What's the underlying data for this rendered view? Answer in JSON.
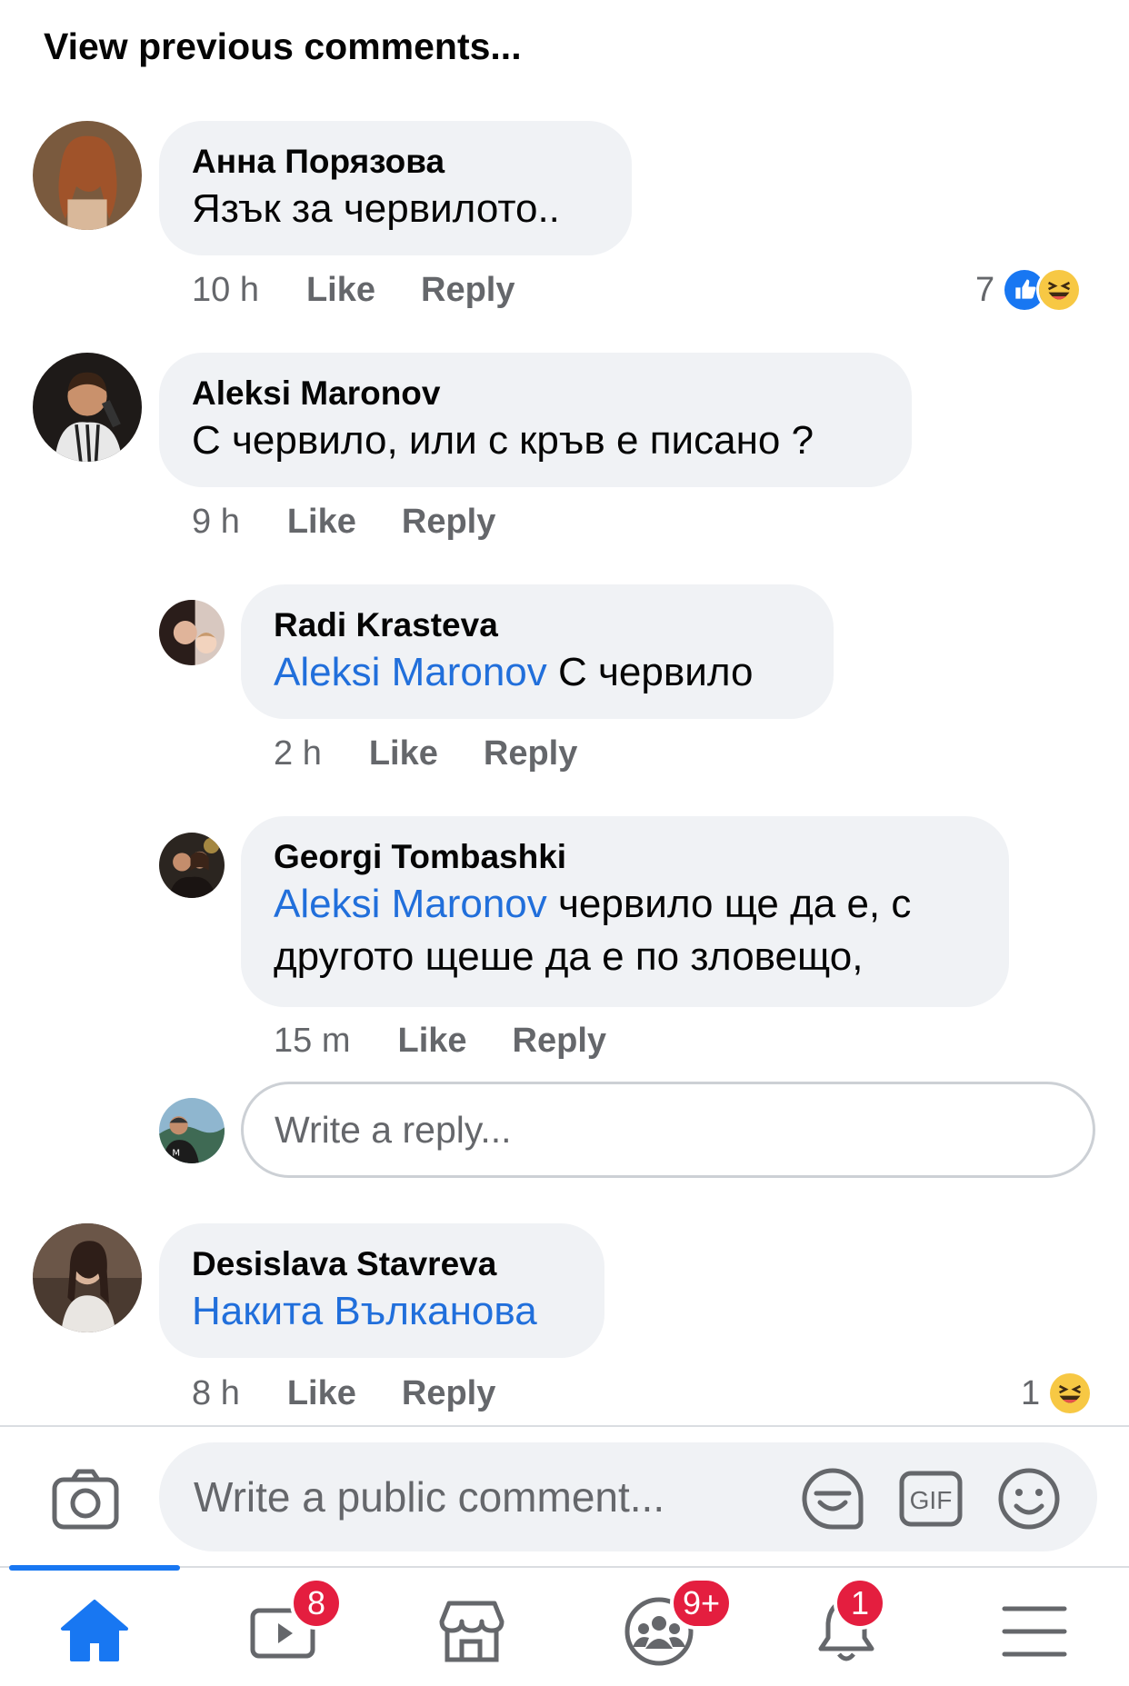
{
  "header": {
    "view_previous": "View previous comments..."
  },
  "comments": [
    {
      "author": "Анна Порязова",
      "text": "Язък за червилото..",
      "time": "10 h",
      "like": "Like",
      "reply": "Reply",
      "reactions": {
        "count": "7",
        "types": [
          "like",
          "haha"
        ]
      }
    },
    {
      "author": "Aleksi Maronov",
      "text": "С червило, или с кръв е писано ?",
      "time": "9 h",
      "like": "Like",
      "reply": "Reply",
      "replies": [
        {
          "author": "Radi Krasteva",
          "mention": "Aleksi Maronov",
          "text": " С червило",
          "time": "2 h",
          "like": "Like",
          "reply": "Reply"
        },
        {
          "author": "Georgi Tombashki",
          "mention": "Aleksi Maronov",
          "text": " червило ще да е, с другото щеше да е по зловещо,",
          "time": "15 m",
          "like": "Like",
          "reply": "Reply"
        }
      ],
      "reply_placeholder": "Write a reply..."
    },
    {
      "author": "Desislava Stavreva",
      "mention": "Накита Вълканова",
      "time": "8 h",
      "like": "Like",
      "reply": "Reply",
      "reactions": {
        "count": "1",
        "types": [
          "haha"
        ]
      }
    }
  ],
  "composer": {
    "placeholder": "Write a public comment...",
    "icons": [
      "camera-icon",
      "sticker-icon",
      "gif-icon",
      "emoji-icon"
    ],
    "gif_label": "GIF"
  },
  "tabbar": {
    "tabs": [
      {
        "name": "home",
        "icon": "home-icon",
        "active": true
      },
      {
        "name": "watch",
        "icon": "video-icon",
        "badge": "8"
      },
      {
        "name": "marketplace",
        "icon": "marketplace-icon"
      },
      {
        "name": "groups",
        "icon": "groups-icon",
        "badge": "9+"
      },
      {
        "name": "notifications",
        "icon": "bell-icon",
        "badge": "1"
      },
      {
        "name": "menu",
        "icon": "menu-icon"
      }
    ]
  },
  "colors": {
    "accent": "#1877f2",
    "mention": "#216fdb",
    "bubble": "#f0f2f5",
    "secondary_text": "#65676b",
    "badge": "#e41e3f"
  }
}
